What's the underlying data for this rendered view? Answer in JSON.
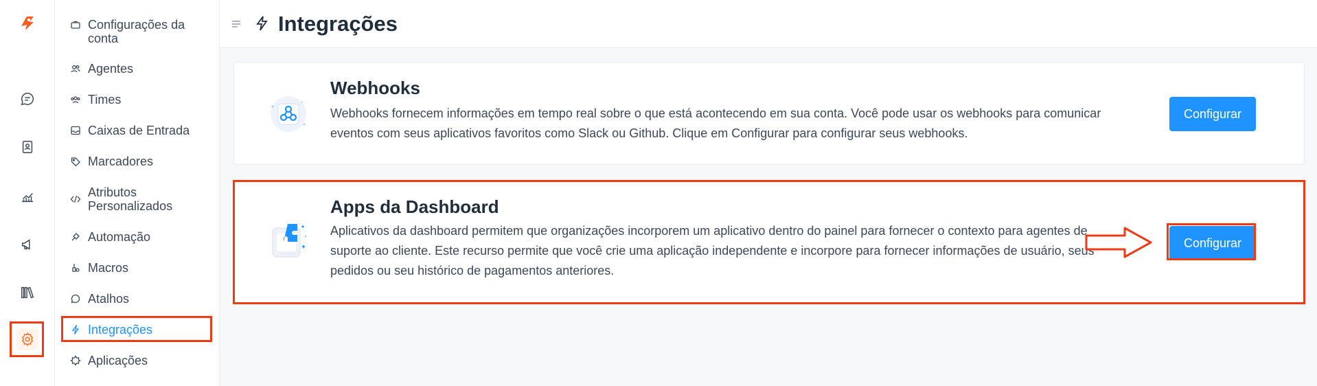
{
  "rail": {
    "items": [
      {
        "name": "conversations-icon"
      },
      {
        "name": "contacts-icon"
      },
      {
        "name": "reports-icon"
      },
      {
        "name": "campaigns-icon"
      },
      {
        "name": "library-icon"
      },
      {
        "name": "settings-icon",
        "active": true
      }
    ]
  },
  "sidebar": {
    "items": [
      {
        "label": "Configurações da conta",
        "icon": "briefcase-icon"
      },
      {
        "label": "Agentes",
        "icon": "people-icon"
      },
      {
        "label": "Times",
        "icon": "team-icon"
      },
      {
        "label": "Caixas de Entrada",
        "icon": "inbox-icon"
      },
      {
        "label": "Marcadores",
        "icon": "tag-icon"
      },
      {
        "label": "Atributos Personalizados",
        "icon": "code-icon"
      },
      {
        "label": "Automação",
        "icon": "automation-icon"
      },
      {
        "label": "Macros",
        "icon": "macro-icon"
      },
      {
        "label": "Atalhos",
        "icon": "chat-shortcut-icon"
      },
      {
        "label": "Integrações",
        "icon": "bolt-icon",
        "active": true
      },
      {
        "label": "Aplicações",
        "icon": "apps-icon"
      }
    ]
  },
  "header": {
    "title": "Integrações"
  },
  "cards": [
    {
      "title": "Webhooks",
      "description": "Webhooks fornecem informações em tempo real sobre o que está acontecendo em sua conta. Você pode usar os webhooks para comunicar eventos com seus aplicativos favoritos como Slack ou Github. Clique em Configurar para configurar seus webhooks.",
      "button": "Configurar",
      "icon": "webhook-icon"
    },
    {
      "title": "Apps da Dashboard",
      "description": "Aplicativos da dashboard permitem que organizações incorporem um aplicativo dentro do painel para fornecer o contexto para agentes de suporte ao cliente. Este recurso permite que você crie uma aplicação independente e incorpore para fornecer informações de usuário, seus pedidos ou seu histórico de pagamentos anteriores.",
      "button": "Configurar",
      "icon": "puzzle-icon"
    }
  ],
  "colors": {
    "accent": "#1f93ff",
    "highlight": "#ee3b14",
    "brand": "#ff6a1a"
  }
}
